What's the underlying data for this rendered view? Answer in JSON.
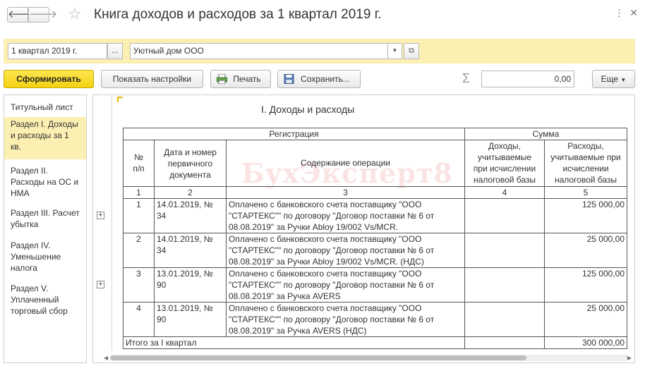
{
  "window": {
    "title": "Книга доходов и расходов за 1 квартал 2019 г.",
    "back_glyph": "🡐",
    "forward_glyph": "🡒",
    "favorite_icon": "star-icon",
    "controls": "⋮ ✕"
  },
  "params": {
    "period": "1 квартал 2019 г.",
    "period_button": "...",
    "organization": "Уютный дом ООО"
  },
  "toolbar": {
    "generate_label": "Сформировать",
    "settings_label": "Показать настройки",
    "print_label": "Печать",
    "save_label": "Сохранить...",
    "sum_symbol": "Σ",
    "sum_value": "0,00",
    "more_label": "Еще"
  },
  "sections": [
    {
      "label": "Титульный лист"
    },
    {
      "label": "Раздел I. Доходы\nи расходы за 1\nкв."
    },
    {
      "label": "Раздел II.\nРасходы на ОС и\nНМА"
    },
    {
      "label": "Раздел III. Расчет\nубытка"
    },
    {
      "label": "Раздел IV.\nУменьшение\nналога"
    },
    {
      "label": "Раздел V.\nУплаченный\nторговый сбор"
    }
  ],
  "report": {
    "title": "I. Доходы и расходы",
    "watermark": "БухЭксперт8",
    "headers": {
      "registration": "Регистрация",
      "sum": "Сумма",
      "num": "№\nп/п",
      "date_doc": "Дата и номер\nпервичного\nдокумента",
      "content": "Содержание операции",
      "income": "Доходы,\nучитываемые\nпри исчислении\nналоговой базы",
      "expense": "Расходы,\nучитываемые при\nисчислении\nналоговой базы"
    },
    "col_numbers": [
      "1",
      "2",
      "3",
      "4",
      "5"
    ],
    "rows": [
      {
        "num": "1",
        "doc": "14.01.2019, №\n34",
        "content": "Оплачено с банковского счета поставщику \"ООО\n\"СТАРТЕКС\"\" по договору \"Договор поставки № 6 от\n08.08.2019\" за Ручки Abloy 19/002 Vs/MCR.",
        "income": "",
        "expense": "125 000,00"
      },
      {
        "num": "2",
        "doc": "14.01.2019, №\n34",
        "content": "Оплачено с банковского счета поставщику \"ООО\n\"СТАРТЕКС\"\" по договору \"Договор поставки № 6 от\n08.08.2019\" за Ручки Abloy 19/002 Vs/MCR. (НДС)",
        "income": "",
        "expense": "25 000,00"
      },
      {
        "num": "3",
        "doc": "13.01.2019, №\n90",
        "content": "Оплачено с банковского счета поставщику \"ООО\n\"СТАРТЕКС\"\" по договору \"Договор поставки № 6 от\n08.08.2019\" за Ручка AVERS",
        "income": "",
        "expense": "125 000,00"
      },
      {
        "num": "4",
        "doc": "13.01.2019, №\n90",
        "content": "Оплачено с банковского счета поставщику \"ООО\n\"СТАРТЕКС\"\" по договору \"Договор поставки № 6 от\n08.08.2019\" за Ручка AVERS (НДС)",
        "income": "",
        "expense": "25 000,00"
      }
    ],
    "total": {
      "label": "Итого за I квартал",
      "income": "",
      "expense": "300 000,00"
    }
  }
}
